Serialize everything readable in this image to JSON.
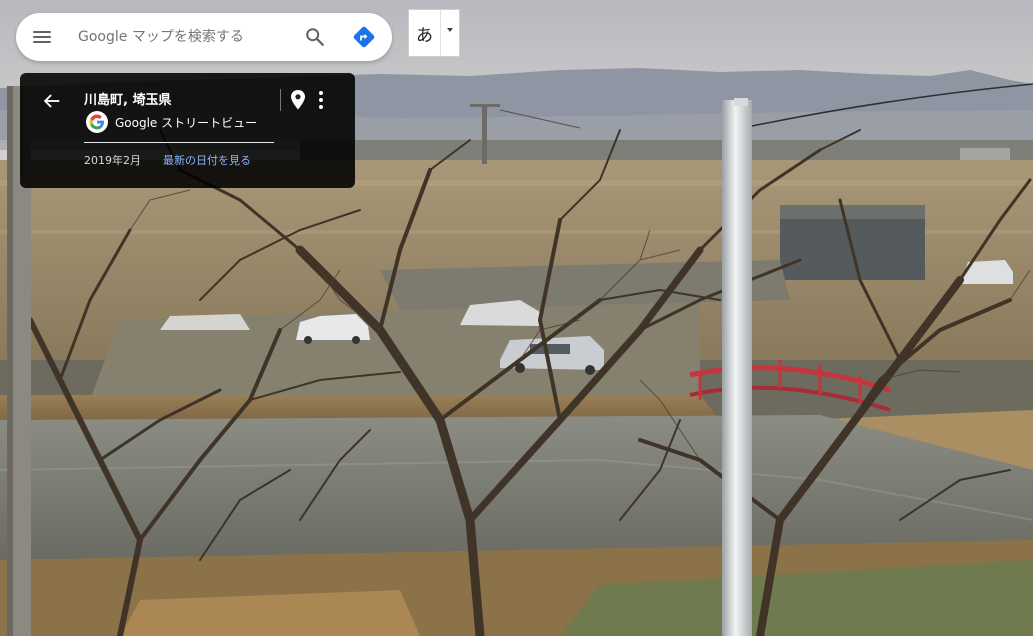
{
  "search": {
    "placeholder": "Google マップを検索する",
    "value": ""
  },
  "ime": {
    "mode_char": "あ"
  },
  "card": {
    "title": "川島町, 埼玉県",
    "service_label": "Google ストリートビュー",
    "capture_date": "2019年2月",
    "latest_link": "最新の日付を見る"
  },
  "icons": {
    "menu": "hamburger-menu-icon",
    "search": "search-icon",
    "directions": "directions-icon",
    "back": "arrow-back-icon",
    "google": "google-g-icon",
    "pin": "location-pin-icon",
    "more": "more-vertical-icon",
    "ime_dropdown": "caret-down-icon"
  },
  "colors": {
    "directions": "#1a73e8",
    "link": "#8ab4f8",
    "card_bg": "#000000"
  }
}
